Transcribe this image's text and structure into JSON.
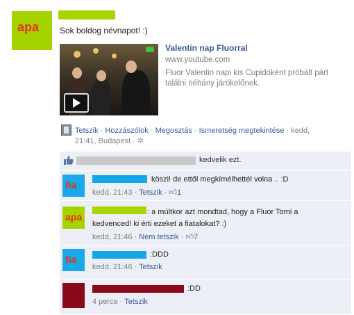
{
  "post": {
    "author_avatar": "apa",
    "message": "Sok boldog névnapot! :)",
    "attachment": {
      "title": "Valentin nap Fluorral",
      "domain": "www.youtube.com",
      "description": "Fluor Valentin napi kis Cupidóként próbált párt találni néhány járókelőnek."
    },
    "actions": {
      "like": "Tetszik",
      "comment": "Hozzászólok",
      "share": "Megosztás",
      "friendship": "Ismeretség megtekintése",
      "time_line1": "kedd,",
      "time_line2": "21:41, Budapest",
      "sep": "·"
    }
  },
  "likes_bar": {
    "text": "kedvelik ezt."
  },
  "comments": [
    {
      "avatar": "fia",
      "avatar_color": "#19a8e8",
      "name_color": "#14a6e8",
      "text": "köszi! de ettől megkímélhettél volna .. :D",
      "time": "kedd, 21:43",
      "like": "Tetszik",
      "likes": "1"
    },
    {
      "avatar": "apa",
      "avatar_color": "#a5d300",
      "name_color": "#a8d400",
      "text_line1": ": a múltkor azt mondtad, hogy a Fluor Tomi a",
      "text_line2": "kedvenced! ki érti ezeket a fiatalokat? :)",
      "time": "kedd, 21:46",
      "like": "Nem tetszik",
      "likes": "7"
    },
    {
      "avatar": "fia",
      "avatar_color": "#19a8e8",
      "name_color": "#14a6e8",
      "text": ":DDD",
      "time": "kedd, 21:46",
      "like": "Tetszik"
    },
    {
      "avatar": "",
      "avatar_color": "#8b0a1a",
      "name_color": "#8b0a1a",
      "text": ":DD",
      "time": "4 perce",
      "like": "Tetszik"
    }
  ],
  "icons": {
    "film": "film-icon",
    "gear": "gear-icon",
    "thumb": "thumbs-up-icon",
    "play": "play-icon"
  },
  "colors": {
    "link": "#3b5998",
    "comment_bg": "#eceff5"
  }
}
